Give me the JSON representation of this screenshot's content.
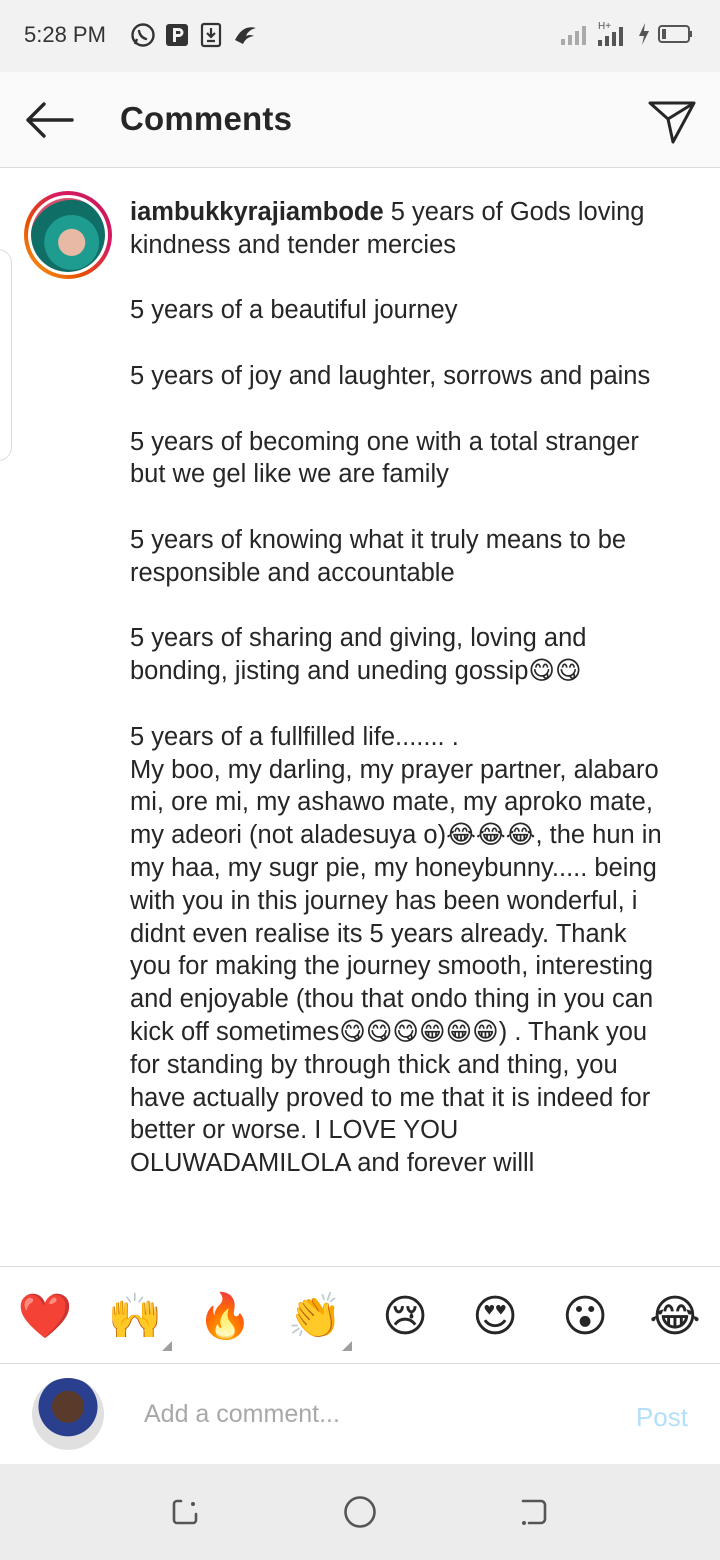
{
  "status_bar": {
    "time": "5:28 PM",
    "left_icons": [
      "whatsapp-icon",
      "p-icon",
      "download-icon",
      "wing-icon"
    ],
    "right_icons": [
      "signal-icon",
      "signal-hplus-icon",
      "charging-icon",
      "battery-icon"
    ],
    "network_label": "H+"
  },
  "header": {
    "title": "Comments",
    "back_icon": "back-arrow-icon",
    "share_icon": "send-icon"
  },
  "caption": {
    "username": "iambukkyrajiambode",
    "paragraphs": [
      " 5 years of Gods loving kindness and tender mercies",
      "5 years of a beautiful journey",
      "5 years of joy and laughter, sorrows and pains",
      "5 years of becoming one with a total stranger but we gel like we are family",
      "5 years of knowing what it truly means to be responsible and accountable",
      "5 years of sharing and giving, loving and bonding, jisting and uneding gossip😋😋",
      "5 years of a fullfilled life....... .\n My boo, my darling, my prayer partner, alabaro mi, ore mi, my ashawo mate, my aproko mate, my adeori (not aladesuya o)😂😂😂, the hun in my haa, my sugr pie, my honeybunny..... being with you in this journey has been wonderful, i didnt even realise its 5 years already. Thank you for making the journey smooth, interesting and enjoyable (thou that ondo thing in you can kick off sometimes😋😋😋😁😁😁) . Thank you for standing by through thick and thing, you have actually proved to me that it is indeed for better or worse. I LOVE YOU OLUWADAMILOLA and forever willl"
    ]
  },
  "emoji_bar": {
    "emojis": [
      "❤️",
      "🙌",
      "🔥",
      "👏",
      "😢",
      "😍",
      "😮",
      "😂"
    ]
  },
  "comment_box": {
    "placeholder": "Add a comment...",
    "post_label": "Post"
  },
  "colors": {
    "post_disabled": "#b2dffc",
    "heart": "#ed4956",
    "story_ring": "#d81b60"
  }
}
